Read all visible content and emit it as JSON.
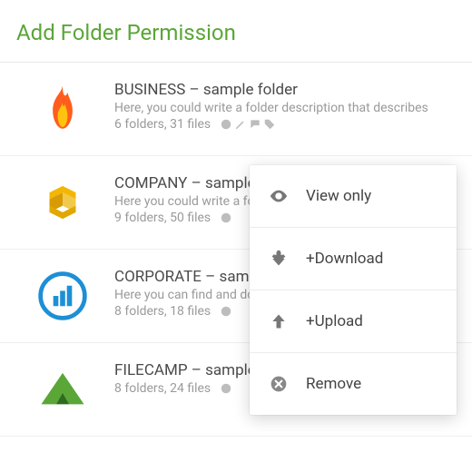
{
  "header": {
    "title": "Add Folder Permission"
  },
  "folders": [
    {
      "title": "BUSINESS – sample folder",
      "desc": "Here, you could write a folder description that describes",
      "stats": "6 folders, 31 files"
    },
    {
      "title": "COMPANY – sample folder",
      "desc": "Here you could write a folder description that",
      "stats": "9 folders, 50 files"
    },
    {
      "title": "CORPORATE – sample folder",
      "desc": "Here you can find and download",
      "stats": "8 folders, 18 files"
    },
    {
      "title": "FILECAMP – sample folder",
      "desc": "",
      "stats": "8 folders, 24 files"
    }
  ],
  "menu": {
    "view": "View only",
    "download": "+Download",
    "upload": "+Upload",
    "remove": "Remove"
  }
}
